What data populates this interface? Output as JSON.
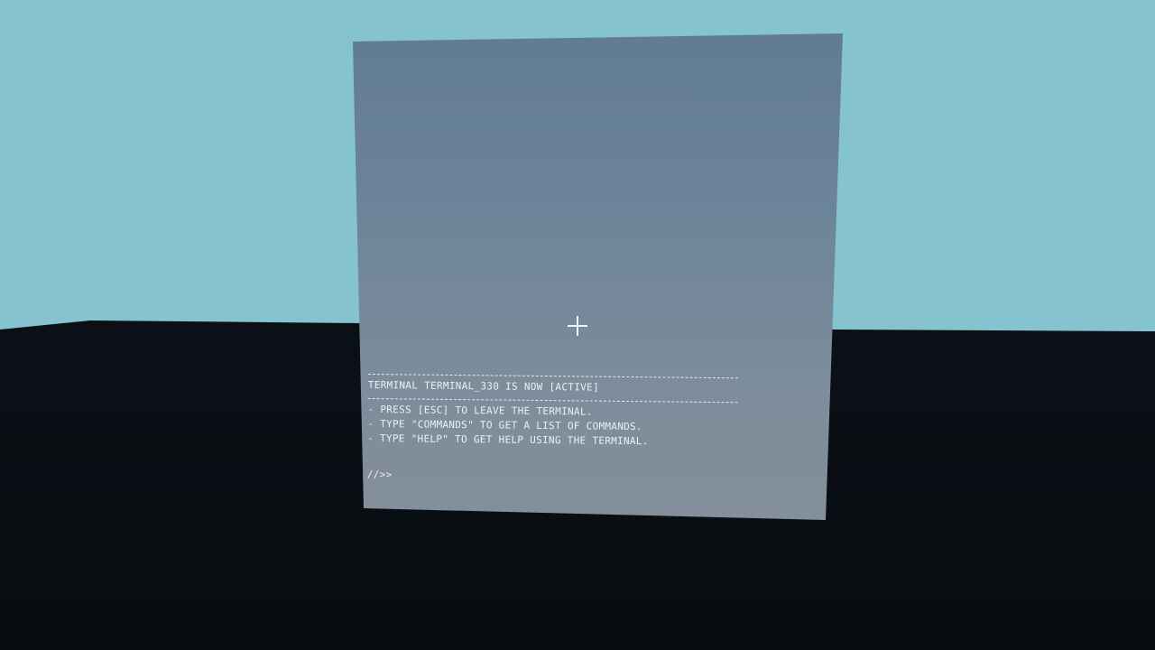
{
  "terminal": {
    "status_line": "TERMINAL TERMINAL_330 IS NOW [ACTIVE]",
    "instructions": [
      "- PRESS [ESC] TO LEAVE THE TERMINAL.",
      "- TYPE \"COMMANDS\" TO GET A LIST OF COMMANDS.",
      "- TYPE \"HELP\" TO GET HELP USING THE TERMINAL."
    ],
    "prompt": "//>>"
  },
  "colors": {
    "sky": "#85c3ce",
    "ground": "#0c1117",
    "panel": "#6b8399",
    "text": "#eef0f2"
  }
}
